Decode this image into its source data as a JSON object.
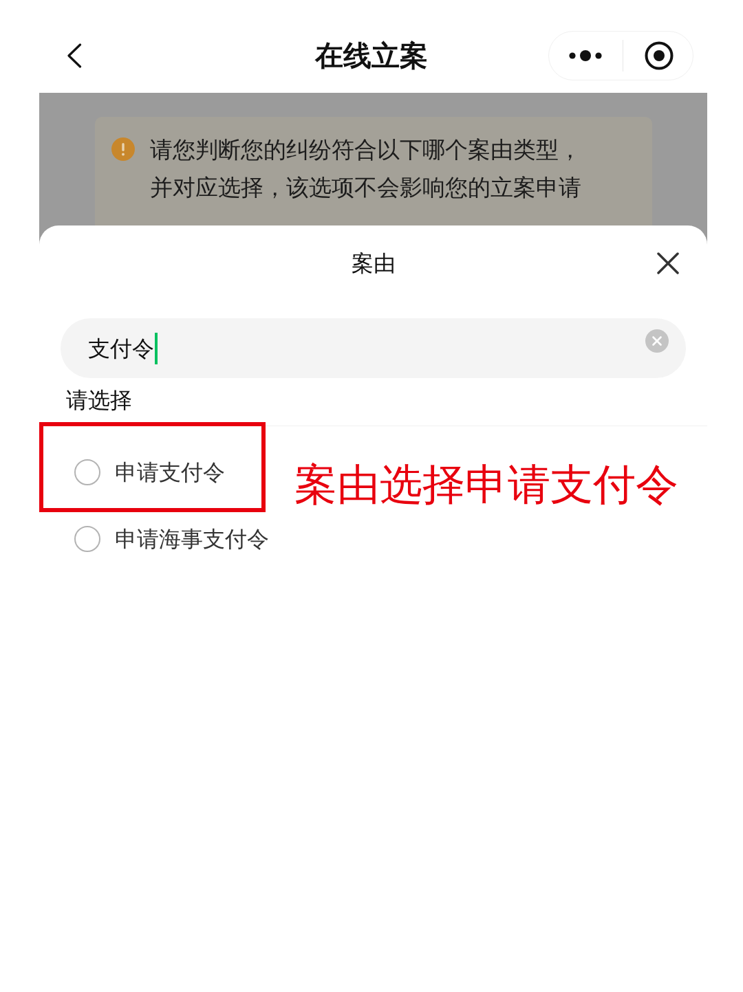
{
  "nav_bar": {
    "title": "在线立案"
  },
  "notice": {
    "text": "请您判断您的纠纷符合以下哪个案由类型，并对应选择，该选项不会影响您的立案申请"
  },
  "sheet": {
    "title": "案由",
    "search": {
      "value": "支付令",
      "focused": true
    },
    "section_label": "请选择",
    "options": [
      {
        "label": "申请支付令",
        "selected": false,
        "highlighted": true
      },
      {
        "label": "申请海事支付令",
        "selected": false,
        "highlighted": false
      }
    ]
  },
  "annotation": {
    "text": "案由选择申请支付令"
  }
}
